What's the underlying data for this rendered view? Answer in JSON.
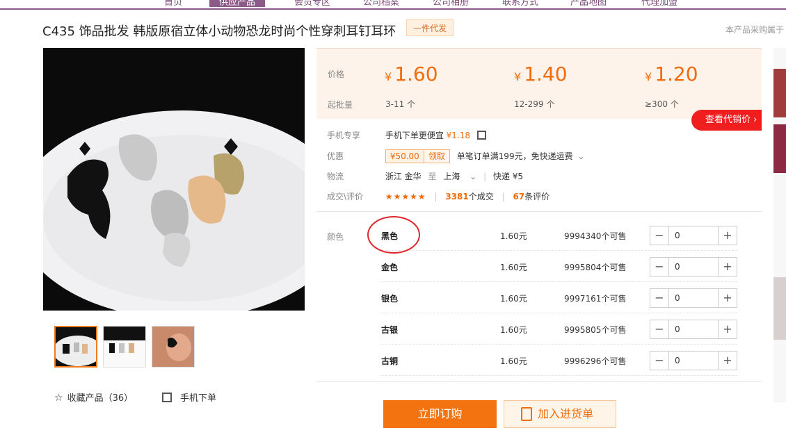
{
  "nav": {
    "items": [
      "首页",
      "供应产品",
      "会员专区",
      "公司档案",
      "公司相册",
      "联系方式",
      "产品地图",
      "代理加盟"
    ]
  },
  "product": {
    "title": "C435 饰品批发 韩版原宿立体小动物恐龙时尚个性穿刺耳钉耳环",
    "tag": "一件代发",
    "right_note": "本产品采购属于"
  },
  "price_box": {
    "price_label": "价格",
    "qty_label": "起批量",
    "tiers": [
      {
        "currency": "¥",
        "price": "1.60",
        "qty": "3-11 个"
      },
      {
        "currency": "¥",
        "price": "1.40",
        "qty": "12-299 个"
      },
      {
        "currency": "¥",
        "price": "1.20",
        "qty": "≥300 个"
      }
    ],
    "agent_button": "查看代销价 ›"
  },
  "info": {
    "mobile": {
      "label": "手机专享",
      "text": "手机下单更便宜",
      "price": "¥1.18"
    },
    "discount": {
      "label": "优惠",
      "coupon_amount": "¥50.00",
      "coupon_action": "领取",
      "text": "单笔订单满199元，免快递运费"
    },
    "logistics": {
      "label": "物流",
      "from": "浙江 金华",
      "to_word": "至",
      "to": "上海",
      "method": "快递 ¥5"
    },
    "deals": {
      "label": "成交\\评价",
      "stars": "★★★★★",
      "deals_count": "3381",
      "deals_unit": "个成交",
      "review_count": "67",
      "review_unit": "条评价"
    }
  },
  "sku": {
    "color_label": "颜色",
    "rows": [
      {
        "name": "黑色",
        "price": "1.60元",
        "stock": "9994340个可售",
        "qty": "0"
      },
      {
        "name": "金色",
        "price": "1.60元",
        "stock": "9995804个可售",
        "qty": "0"
      },
      {
        "name": "银色",
        "price": "1.60元",
        "stock": "9997161个可售",
        "qty": "0"
      },
      {
        "name": "古银",
        "price": "1.60元",
        "stock": "9995805个可售",
        "qty": "0"
      },
      {
        "name": "古铜",
        "price": "1.60元",
        "stock": "9996296个可售",
        "qty": "0"
      }
    ]
  },
  "actions": {
    "buy_now": "立即订购",
    "add_cart": "加入进货单",
    "favorite": "收藏产品（36）",
    "mobile_order": "手机下单"
  }
}
